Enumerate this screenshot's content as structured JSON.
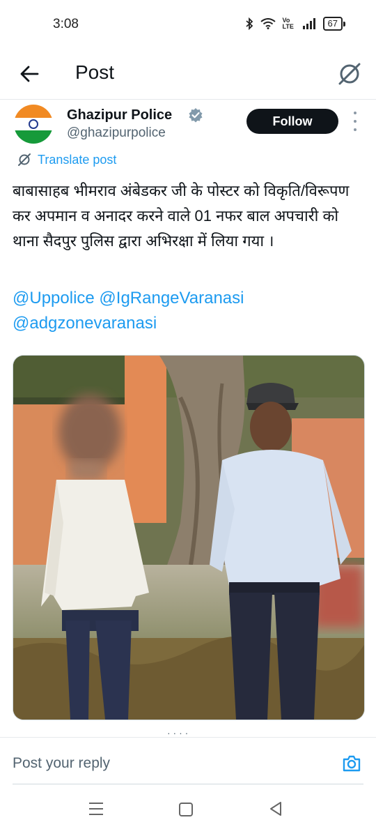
{
  "status_bar": {
    "time": "3:08",
    "network_label": "Vo LTE",
    "battery": "67"
  },
  "header": {
    "title": "Post"
  },
  "author": {
    "name": "Ghazipur Police",
    "handle": "@ghazipurpolice",
    "follow_label": "Follow",
    "verified": true
  },
  "post": {
    "translate_label": "Translate post",
    "text": "बाबासाहब भीमराव अंबेडकर जी के पोस्टर को विकृति/विरूपण कर अपमान व अनादर करने वाले 01 नफर बाल अपचारी को थाना सैदपुर  पुलिस द्वारा अभिरक्षा में लिया गया ।",
    "mentions": [
      "@Uppolice",
      "@IgRangeVaranasi",
      "@adgzonevaranasi"
    ]
  },
  "reply": {
    "placeholder": "Post your reply"
  },
  "icons": {
    "back": "arrow-left-icon",
    "grok": "grok-icon",
    "translate": "translate-icon",
    "verified": "verified-badge-icon",
    "more": "more-vertical-icon",
    "camera": "camera-icon"
  },
  "colors": {
    "accent": "#1d9bf0",
    "text": "#0f1419",
    "secondary": "#536471",
    "follow_bg": "#0f1419"
  }
}
